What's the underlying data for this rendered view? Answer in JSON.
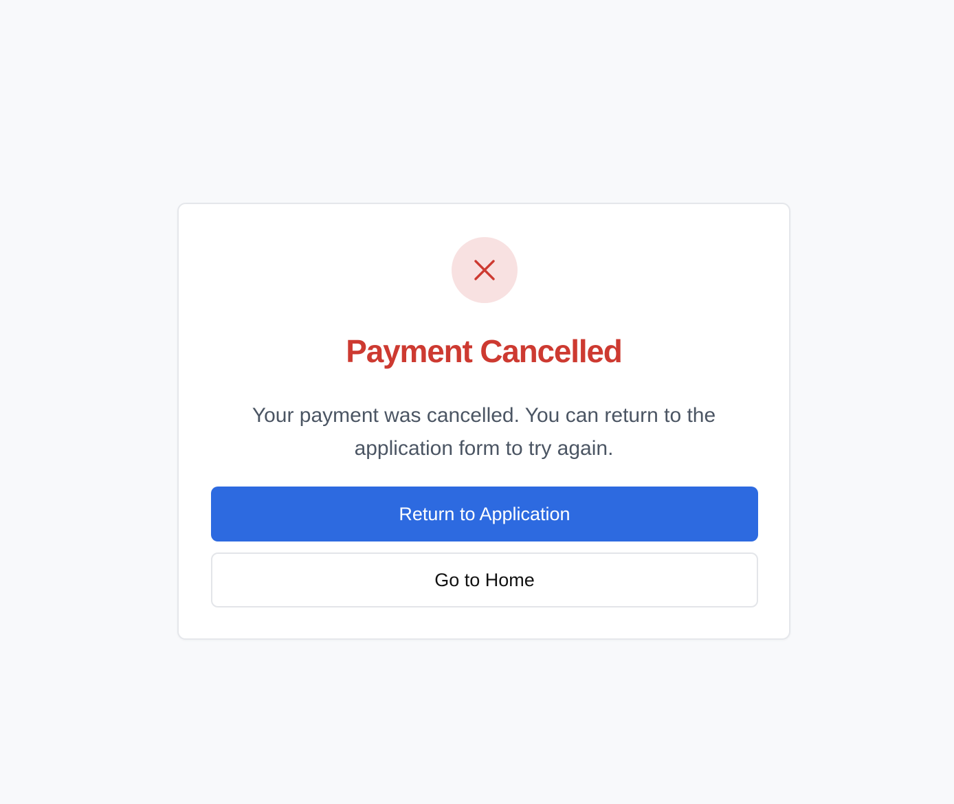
{
  "card": {
    "title": "Payment Cancelled",
    "message": "Your payment was cancelled. You can return to the application form to try again.",
    "icon": "x-icon"
  },
  "actions": {
    "primary_label": "Return to Application",
    "secondary_label": "Go to Home"
  },
  "colors": {
    "background": "#f8f9fb",
    "error": "#cd3a31",
    "error_tint": "#f8e1e1",
    "primary": "#2d6ae0",
    "text_muted": "#4b5563"
  }
}
